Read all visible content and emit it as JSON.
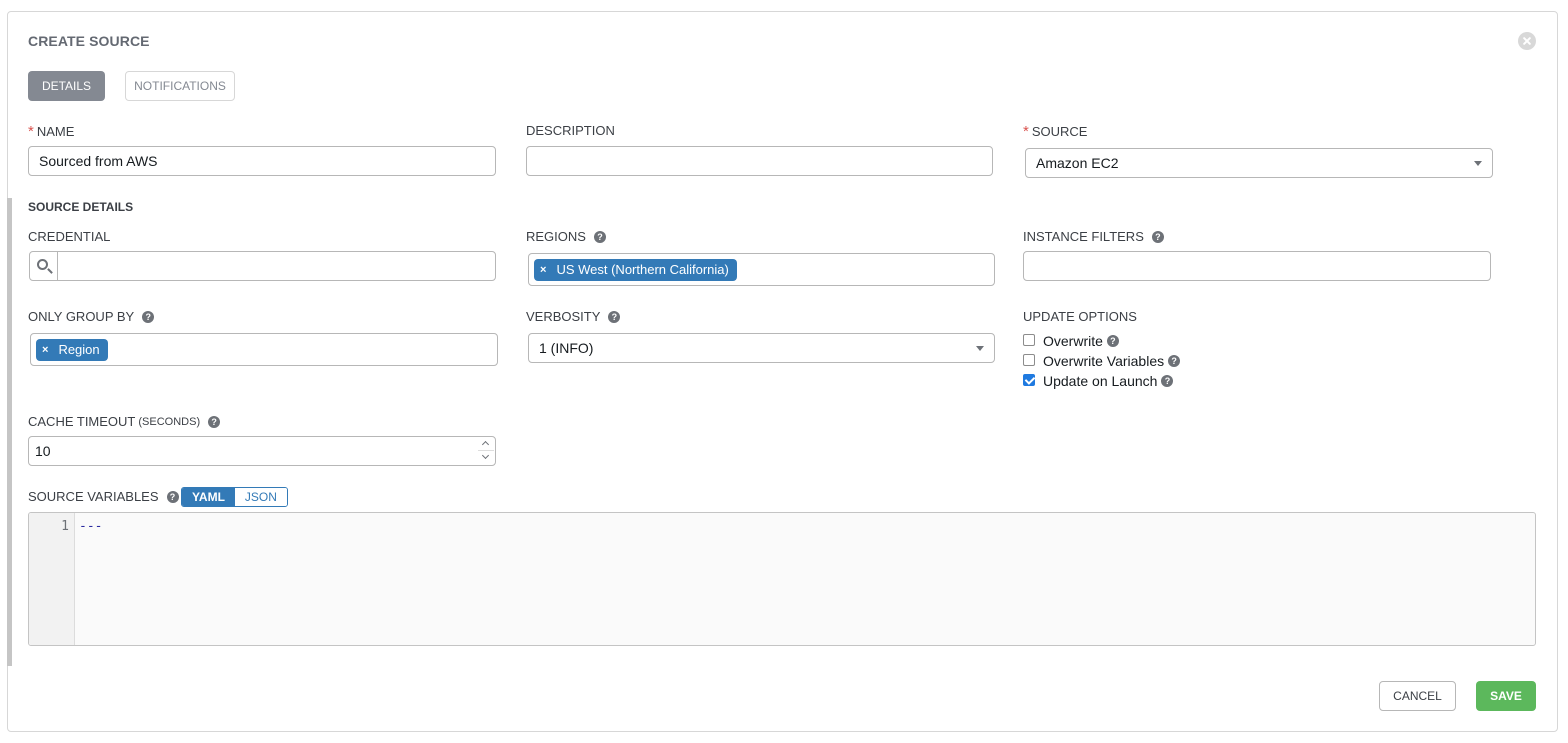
{
  "dialog": {
    "title": "CREATE SOURCE",
    "tabs": [
      {
        "label": "DETAILS",
        "active": true
      },
      {
        "label": "NOTIFICATIONS",
        "active": false
      }
    ]
  },
  "fields": {
    "name": {
      "label": "NAME",
      "required": true,
      "value": "Sourced from AWS"
    },
    "description": {
      "label": "DESCRIPTION",
      "value": ""
    },
    "source": {
      "label": "SOURCE",
      "required": true,
      "value": "Amazon EC2"
    }
  },
  "source_details": {
    "title": "SOURCE DETAILS",
    "credential": {
      "label": "CREDENTIAL",
      "value": ""
    },
    "regions": {
      "label": "REGIONS",
      "tags": [
        "US West (Northern California)"
      ]
    },
    "instance_filters": {
      "label": "INSTANCE FILTERS",
      "value": ""
    },
    "only_group_by": {
      "label": "ONLY GROUP BY",
      "tags": [
        "Region"
      ]
    },
    "verbosity": {
      "label": "VERBOSITY",
      "value": "1 (INFO)"
    },
    "update_options": {
      "label": "UPDATE OPTIONS",
      "items": [
        {
          "label": "Overwrite",
          "checked": false
        },
        {
          "label": "Overwrite Variables",
          "checked": false
        },
        {
          "label": "Update on Launch",
          "checked": true
        }
      ]
    },
    "cache_timeout": {
      "label": "CACHE TIMEOUT",
      "unit": "(SECONDS)",
      "value": "10"
    },
    "source_variables": {
      "label": "SOURCE VARIABLES",
      "modes": [
        "YAML",
        "JSON"
      ],
      "active_mode": "YAML",
      "line_number": "1",
      "content": "---"
    }
  },
  "actions": {
    "cancel": "CANCEL",
    "save": "SAVE"
  },
  "icons": {
    "help": "question-circle-icon",
    "close": "close-circle-icon",
    "search": "search-icon",
    "remove_tag": "times-icon"
  },
  "colors": {
    "tag": "#337ab7",
    "save": "#5cb85c",
    "active_tab": "#848992",
    "required": "#d9534f"
  }
}
